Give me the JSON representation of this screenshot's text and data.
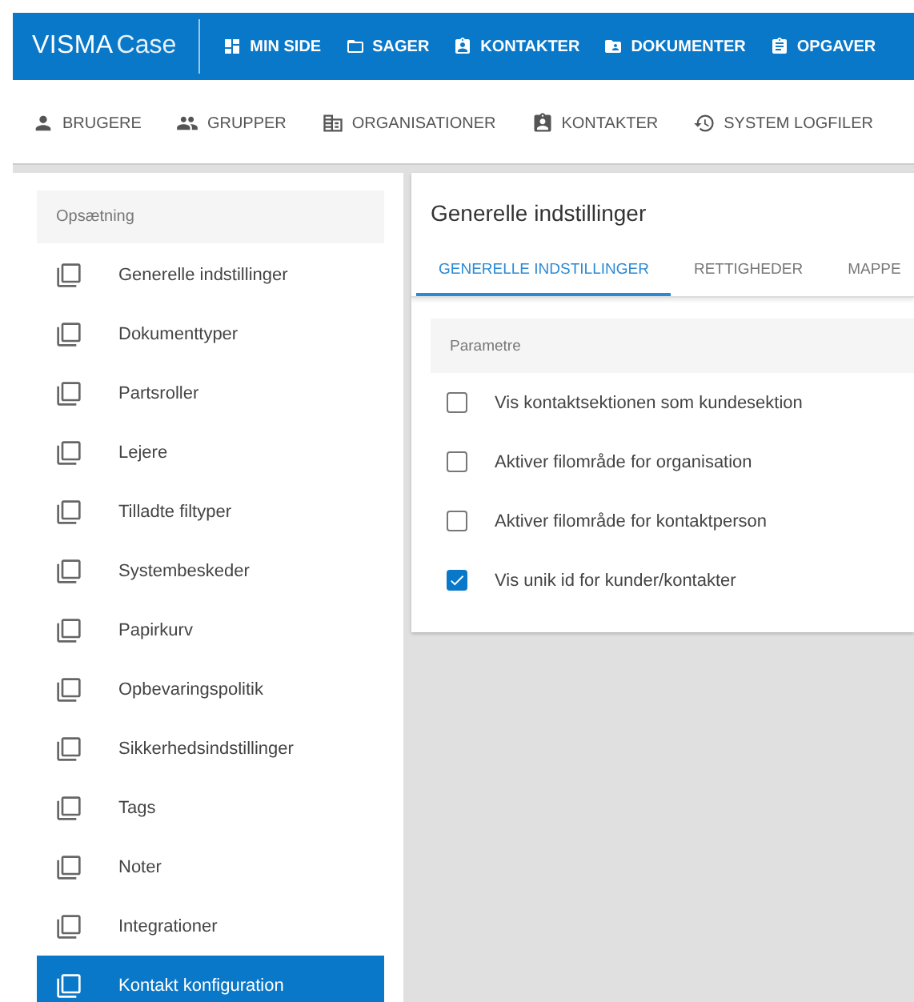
{
  "brand": {
    "main": "VISMA",
    "sub": "Case"
  },
  "top_nav": [
    {
      "label": "MIN SIDE"
    },
    {
      "label": "SAGER"
    },
    {
      "label": "KONTAKTER"
    },
    {
      "label": "DOKUMENTER"
    },
    {
      "label": "OPGAVER"
    }
  ],
  "sub_nav": [
    {
      "label": "BRUGERE"
    },
    {
      "label": "GRUPPER"
    },
    {
      "label": "ORGANISATIONER"
    },
    {
      "label": "KONTAKTER"
    },
    {
      "label": "SYSTEM LOGFILER"
    }
  ],
  "sidebar": {
    "header": "Opsætning",
    "items": [
      {
        "label": "Generelle indstillinger",
        "selected": false
      },
      {
        "label": "Dokumenttyper",
        "selected": false
      },
      {
        "label": "Partsroller",
        "selected": false
      },
      {
        "label": "Lejere",
        "selected": false
      },
      {
        "label": "Tilladte filtyper",
        "selected": false
      },
      {
        "label": "Systembeskeder",
        "selected": false
      },
      {
        "label": "Papirkurv",
        "selected": false
      },
      {
        "label": "Opbevaringspolitik",
        "selected": false
      },
      {
        "label": "Sikkerhedsindstillinger",
        "selected": false
      },
      {
        "label": "Tags",
        "selected": false
      },
      {
        "label": "Noter",
        "selected": false
      },
      {
        "label": "Integrationer",
        "selected": false
      },
      {
        "label": "Kontakt konfiguration",
        "selected": true
      }
    ]
  },
  "panel": {
    "title": "Generelle indstillinger",
    "tabs": [
      {
        "label": "GENERELLE INDSTILLINGER",
        "selected": true
      },
      {
        "label": "RETTIGHEDER",
        "selected": false
      },
      {
        "label": "MAPPE",
        "selected": false
      }
    ],
    "section_header": "Parametre",
    "options": [
      {
        "label": "Vis kontaktsektionen som kundesektion",
        "checked": false
      },
      {
        "label": "Aktiver filområde for organisation",
        "checked": false
      },
      {
        "label": "Aktiver filområde for kontaktperson",
        "checked": false
      },
      {
        "label": "Vis unik id for kunder/kontakter",
        "checked": true
      }
    ]
  }
}
